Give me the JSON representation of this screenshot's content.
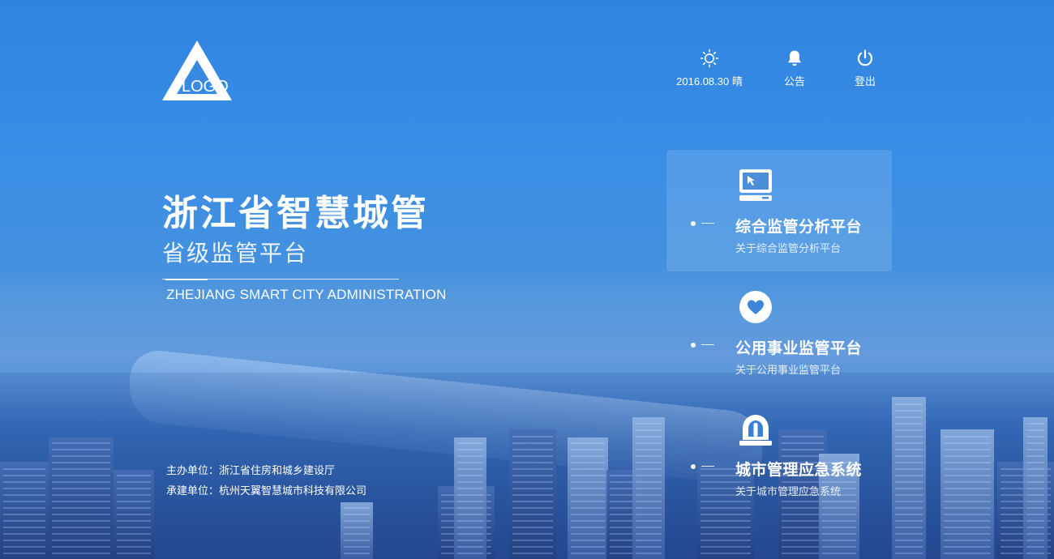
{
  "header": {
    "logo_text": "LOGO",
    "weather": {
      "label": "2016.08.30 晴",
      "icon": "sun-icon"
    },
    "notice": {
      "label": "公告",
      "icon": "bell-icon"
    },
    "logout": {
      "label": "登出",
      "icon": "power-icon"
    }
  },
  "hero": {
    "title": "浙江省智慧城管",
    "subtitle": "省级监管平台",
    "english": "ZHEJIANG SMART CITY ADMINISTRATION"
  },
  "sponsors": {
    "host": "主办单位：浙江省住房和城乡建设厅",
    "builder": "承建单位：杭州天翼智慧城市科技有限公司"
  },
  "platforms": [
    {
      "title": "综合监管分析平台",
      "desc": "关于综合监管分析平台",
      "icon": "monitor-cursor-icon",
      "active": true
    },
    {
      "title": "公用事业监管平台",
      "desc": "关于公用事业监管平台",
      "icon": "heart-icon",
      "active": false
    },
    {
      "title": "城市管理应急系统",
      "desc": "关于城市管理应急系统",
      "icon": "alarm-light-icon",
      "active": false
    }
  ],
  "colors": {
    "background_top": "#2f84e0",
    "background_bottom": "#2d5fa8",
    "text": "#ffffff"
  }
}
